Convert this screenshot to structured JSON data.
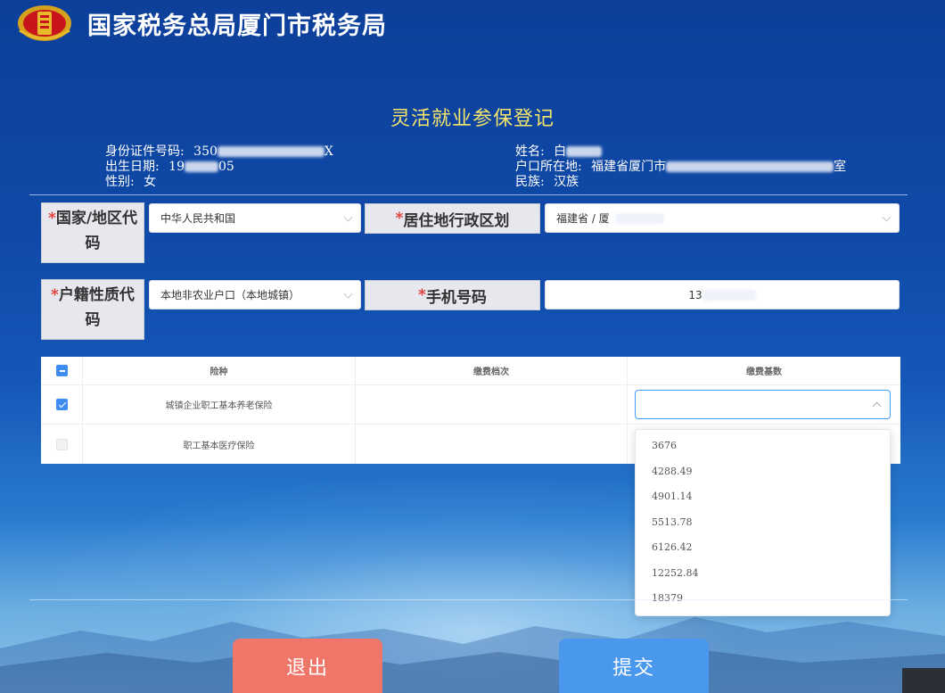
{
  "header": {
    "title": "国家税务总局厦门市税务局"
  },
  "page": {
    "title": "灵活就业参保登记"
  },
  "info": {
    "id_label": "身份证件号码:",
    "id_prefix": "350",
    "id_suffix": "X",
    "birth_label": "出生日期:",
    "birth_prefix": "19",
    "birth_suffix": "05",
    "gender_label": "性别:",
    "gender_value": "女",
    "name_label": "姓名:",
    "name_prefix": "白",
    "hukou_label": "户口所在地:",
    "hukou_prefix": "福建省厦门市",
    "hukou_suffix": "室",
    "ethnicity_label": "民族:",
    "ethnicity_value": "汉族"
  },
  "form": {
    "country_label_req": "*",
    "country_label_line1": "国家/地区代",
    "country_label_line2": "码",
    "country_value": "中华人民共和国",
    "residence_label_req": "*",
    "residence_label": "居住地行政区划",
    "residence_value_prefix": "福建省 / 厦",
    "hukou_type_label_req": "*",
    "hukou_type_label_line1": "户籍性质代",
    "hukou_type_label_line2": "码",
    "hukou_type_value": "本地非农业户口（本地城镇）",
    "phone_label_req": "*",
    "phone_label": "手机号码",
    "phone_prefix": "13"
  },
  "table": {
    "headers": {
      "insurance": "险种",
      "grade": "缴费档次",
      "base": "缴费基数"
    },
    "rows": [
      {
        "insurance": "城镇企业职工基本养老保险",
        "checked": true
      },
      {
        "insurance": "职工基本医疗保险",
        "checked": false
      }
    ]
  },
  "dropdown": {
    "options": [
      "3676",
      "4288.49",
      "4901.14",
      "5513.78",
      "6126.42",
      "12252.84",
      "18379"
    ]
  },
  "buttons": {
    "exit": "退出",
    "submit": "提交"
  },
  "colors": {
    "title_yellow": "#f5e46a",
    "required_red": "#e0322a",
    "exit_button": "#f0766a",
    "submit_button": "#4a98ee",
    "checkbox_blue": "#3f8cf0"
  }
}
